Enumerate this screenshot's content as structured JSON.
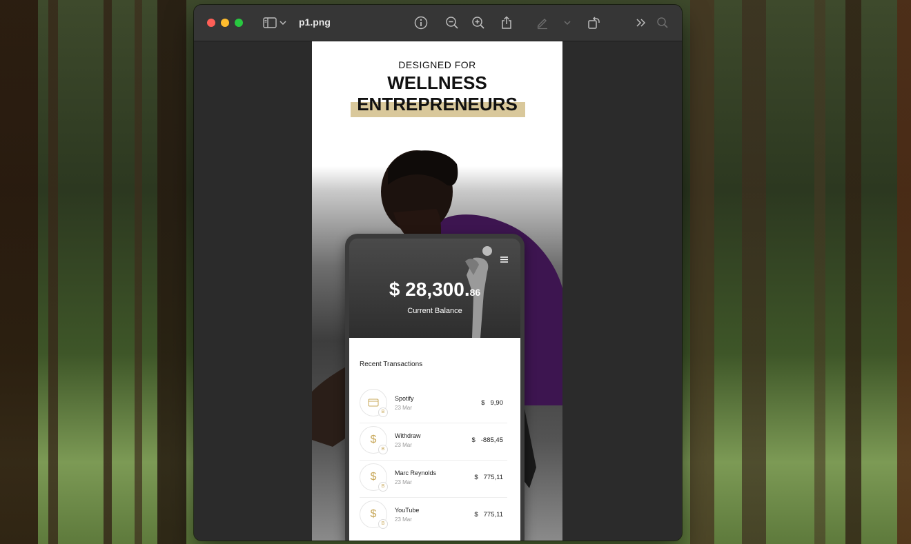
{
  "window": {
    "filename": "p1.png"
  },
  "toolbar": {
    "icons": [
      "sidebar-icon",
      "chevron-down-icon",
      "info-icon",
      "zoom-out-icon",
      "zoom-in-icon",
      "share-icon",
      "markup-pen-icon",
      "chevron-down-icon",
      "rotate-icon",
      "more-icon",
      "search-icon"
    ]
  },
  "document": {
    "headline_small": "DESIGNED FOR",
    "headline_line1": "WELLNESS",
    "headline_line2": "ENTREPRENEURS",
    "accent_color": "#d9c89b",
    "balance": {
      "currency": "$",
      "amount": "28,300.",
      "cents": "86",
      "label": "Current Balance"
    },
    "recent_title": "Recent Transactions",
    "transactions": [
      {
        "name": "Spotify",
        "date": "23 Mar",
        "currency": "$",
        "amount": "9,90",
        "icon": "card-icon",
        "badge": "B"
      },
      {
        "name": "Withdraw",
        "date": "23 Mar",
        "currency": "$",
        "amount": "-885,45",
        "icon": "dollar-icon",
        "badge": "B"
      },
      {
        "name": "Marc Reynolds",
        "date": "23 Mar",
        "currency": "$",
        "amount": "775,11",
        "icon": "dollar-icon",
        "badge": "B"
      },
      {
        "name": "YouTube",
        "date": "23 Mar",
        "currency": "$",
        "amount": "775,11",
        "icon": "dollar-icon",
        "badge": "B"
      }
    ]
  }
}
